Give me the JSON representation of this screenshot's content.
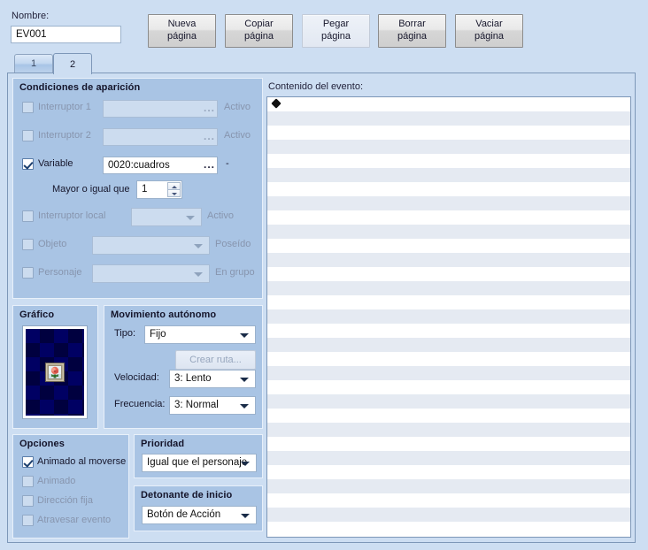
{
  "header": {
    "name_label": "Nombre:",
    "name_value": "EV001",
    "buttons": [
      {
        "label": "Nueva\npágina",
        "enabled": true
      },
      {
        "label": "Copiar\npágina",
        "enabled": true
      },
      {
        "label": "Pegar\npágina",
        "enabled": false
      },
      {
        "label": "Borrar\npágina",
        "enabled": true
      },
      {
        "label": "Vaciar\npágina",
        "enabled": true
      }
    ]
  },
  "tabs": [
    {
      "label": "1",
      "active": false
    },
    {
      "label": "2",
      "active": true
    }
  ],
  "conditions": {
    "title": "Condiciones de aparición",
    "switch1": {
      "label": "Interruptor 1",
      "checked": false,
      "value": "",
      "suffix": "Activo",
      "ellipsis": "..."
    },
    "switch2": {
      "label": "Interruptor 2",
      "checked": false,
      "value": "",
      "suffix": "Activo",
      "ellipsis": "..."
    },
    "variable": {
      "label": "Variable",
      "checked": true,
      "value": "0020:cuadros",
      "suffix": "-",
      "ellipsis": "..."
    },
    "operator": {
      "label": "Mayor o igual que",
      "value": "1"
    },
    "local_switch": {
      "label": "Interruptor local",
      "checked": false,
      "value": "",
      "suffix": "Activo"
    },
    "item": {
      "label": "Objeto",
      "checked": false,
      "value": "",
      "suffix": "Poseído"
    },
    "actor": {
      "label": "Personaje",
      "checked": false,
      "value": "",
      "suffix": "En grupo"
    }
  },
  "graphic": {
    "title": "Gráfico"
  },
  "movement": {
    "title": "Movimiento autónomo",
    "type_label": "Tipo:",
    "type_value": "Fijo",
    "route_button": "Crear ruta...",
    "speed_label": "Velocidad:",
    "speed_value": "3: Lento",
    "freq_label": "Frecuencia:",
    "freq_value": "3: Normal"
  },
  "options": {
    "title": "Opciones",
    "items": [
      {
        "label": "Animado al moverse",
        "checked": true
      },
      {
        "label": "Animado",
        "checked": false
      },
      {
        "label": "Dirección fija",
        "checked": false
      },
      {
        "label": "Atravesar evento",
        "checked": false
      }
    ]
  },
  "priority": {
    "title": "Prioridad",
    "value": "Igual que el personaje"
  },
  "trigger": {
    "title": "Detonante de inicio",
    "value": "Botón de Acción"
  },
  "event_content": {
    "label": "Contenido del evento:",
    "rows": [
      {
        "text": "◆",
        "bullet": true
      },
      {
        "text": ""
      },
      {
        "text": ""
      },
      {
        "text": ""
      },
      {
        "text": ""
      },
      {
        "text": ""
      },
      {
        "text": ""
      },
      {
        "text": ""
      },
      {
        "text": ""
      },
      {
        "text": ""
      },
      {
        "text": ""
      },
      {
        "text": ""
      },
      {
        "text": ""
      },
      {
        "text": ""
      },
      {
        "text": ""
      },
      {
        "text": ""
      },
      {
        "text": ""
      },
      {
        "text": ""
      },
      {
        "text": ""
      },
      {
        "text": ""
      },
      {
        "text": ""
      },
      {
        "text": ""
      },
      {
        "text": ""
      },
      {
        "text": ""
      },
      {
        "text": ""
      },
      {
        "text": ""
      },
      {
        "text": ""
      },
      {
        "text": ""
      },
      {
        "text": ""
      },
      {
        "text": ""
      },
      {
        "text": ""
      }
    ]
  },
  "colors": {
    "window_bg": "#cddef2",
    "group_bg": "#a9c4e4",
    "field_bg": "#ffffff",
    "disabled_field_bg": "#ccdcef",
    "list_stripe": "#e5eaf2",
    "border": "#7d97b8"
  }
}
